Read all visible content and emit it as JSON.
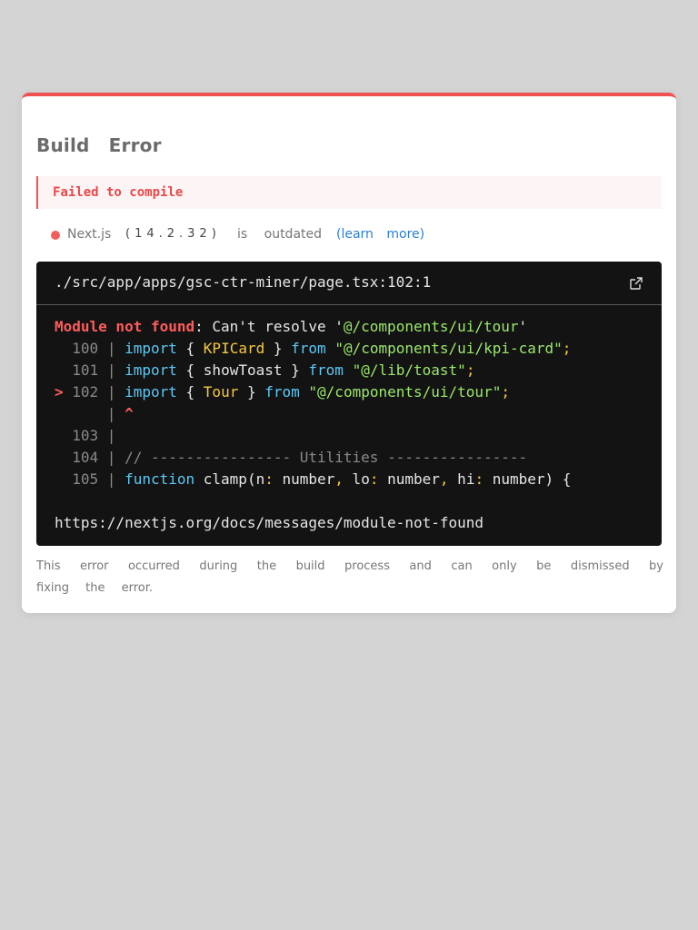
{
  "dialog": {
    "title": "Build Error",
    "banner": "Failed to compile",
    "version": {
      "name": "Next.js",
      "number_text": "(14.2.32)",
      "status_text": "is outdated",
      "learn_more": "(learn more)"
    },
    "code": {
      "file_path": "./src/app/apps/gsc-ctr-miner/page.tsx:102:1",
      "open_icon": "external-link-icon",
      "error_label": "Module not found",
      "error_message": ": Can't resolve '",
      "module_name": "@/components/ui/tour",
      "error_quote_end": "'",
      "lines": [
        {
          "marker": " ",
          "number": "100",
          "keyword": "import",
          "open": " { ",
          "ident": "KPICard",
          "close": " } ",
          "from": "from",
          "space": " ",
          "source": "\"@/components/ui/kpi-card\"",
          "end": ";"
        },
        {
          "marker": " ",
          "number": "101",
          "keyword": "import",
          "open": " { ",
          "ident": "showToast",
          "close": " } ",
          "from": "from",
          "space": " ",
          "source": "\"@/lib/toast\"",
          "end": ";"
        },
        {
          "marker": ">",
          "number": "102",
          "keyword": "import",
          "open": " { ",
          "ident": "Tour",
          "close": " } ",
          "from": "from",
          "space": " ",
          "source": "\"@/components/ui/tour\"",
          "end": ";"
        }
      ],
      "caret": "^",
      "line_103": "103",
      "line_104_number": "104",
      "line_104_comment": "// ---------------- Utilities ----------------",
      "line_105_number": "105",
      "line_105_keyword": "function",
      "line_105_code": " clamp(n",
      "line_105_colon1": ":",
      "line_105_type1": " number",
      "line_105_comma1": ",",
      "line_105_p2": " lo",
      "line_105_colon2": ":",
      "line_105_type2": " number",
      "line_105_comma2": ",",
      "line_105_p3": " hi",
      "line_105_colon3": ":",
      "line_105_tail": " number) {",
      "docs_url": "https://nextjs.org/docs/messages/module-not-found"
    },
    "footer": "This error occurred during the build process and can only be dismissed by fixing the error."
  },
  "colors": {
    "accent_red": "#ef5252",
    "code_bg": "#131313",
    "link_blue": "#2a7fd4"
  }
}
